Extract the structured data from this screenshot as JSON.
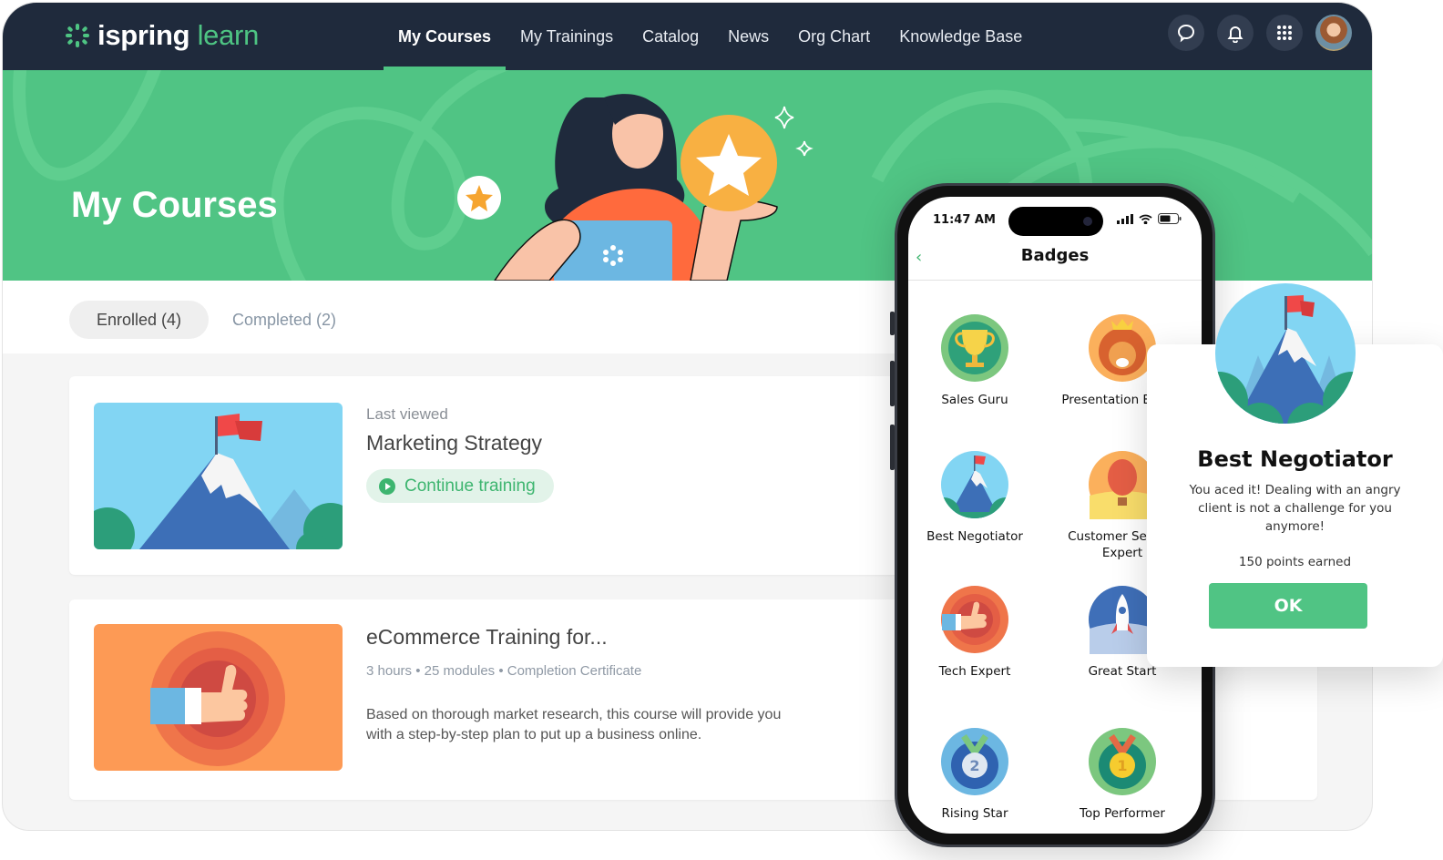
{
  "app": {
    "logo_primary": "ispring",
    "logo_secondary": "learn"
  },
  "nav": {
    "items": [
      {
        "label": "My Courses",
        "active": true
      },
      {
        "label": "My Trainings"
      },
      {
        "label": "Catalog"
      },
      {
        "label": "News"
      },
      {
        "label": "Org Chart"
      },
      {
        "label": "Knowledge Base"
      }
    ],
    "icons": [
      "chat-icon",
      "bell-icon",
      "apps-grid-icon",
      "user-avatar"
    ]
  },
  "hero": {
    "title": "My Courses"
  },
  "tabs": [
    {
      "label": "Enrolled (4)",
      "active": true
    },
    {
      "label": "Completed (2)",
      "active": false
    }
  ],
  "courses": [
    {
      "label": "Last viewed",
      "title": "Marketing Strategy",
      "action": "Continue training",
      "thumbnail": "mountain-flag"
    },
    {
      "title": "eCommerce Training for...",
      "meta": "3 hours • 25 modules  •  Completion Certificate",
      "description": "Based on thorough market research, this course will provide you with a step-by-step plan to put up a business online.",
      "thumbnail": "thumbs-up"
    }
  ],
  "phone": {
    "time": "11:47 AM",
    "title": "Badges",
    "back": "‹",
    "badges": [
      {
        "label": "Sales Guru",
        "icon": "trophy"
      },
      {
        "label": "Presentation Expert",
        "icon": "lion"
      },
      {
        "label": "Best Negotiator",
        "icon": "mountain-flag"
      },
      {
        "label": "Customer Service Expert",
        "icon": "hot-air-balloon"
      },
      {
        "label": "Tech Expert",
        "icon": "thumbs-up"
      },
      {
        "label": "Great Start",
        "icon": "rocket"
      },
      {
        "label": "Rising Star",
        "icon": "medal-2"
      },
      {
        "label": "Top Performer",
        "icon": "medal-1"
      }
    ]
  },
  "popup": {
    "title": "Best Negotiator",
    "text": "You aced it! Dealing with an angry client is not a challenge for you anymore!",
    "points": "150 points earned",
    "ok": "OK"
  },
  "colors": {
    "brand_green": "#50c484",
    "topbar": "#1f2a3c",
    "accent_text_green": "#3db56f"
  }
}
